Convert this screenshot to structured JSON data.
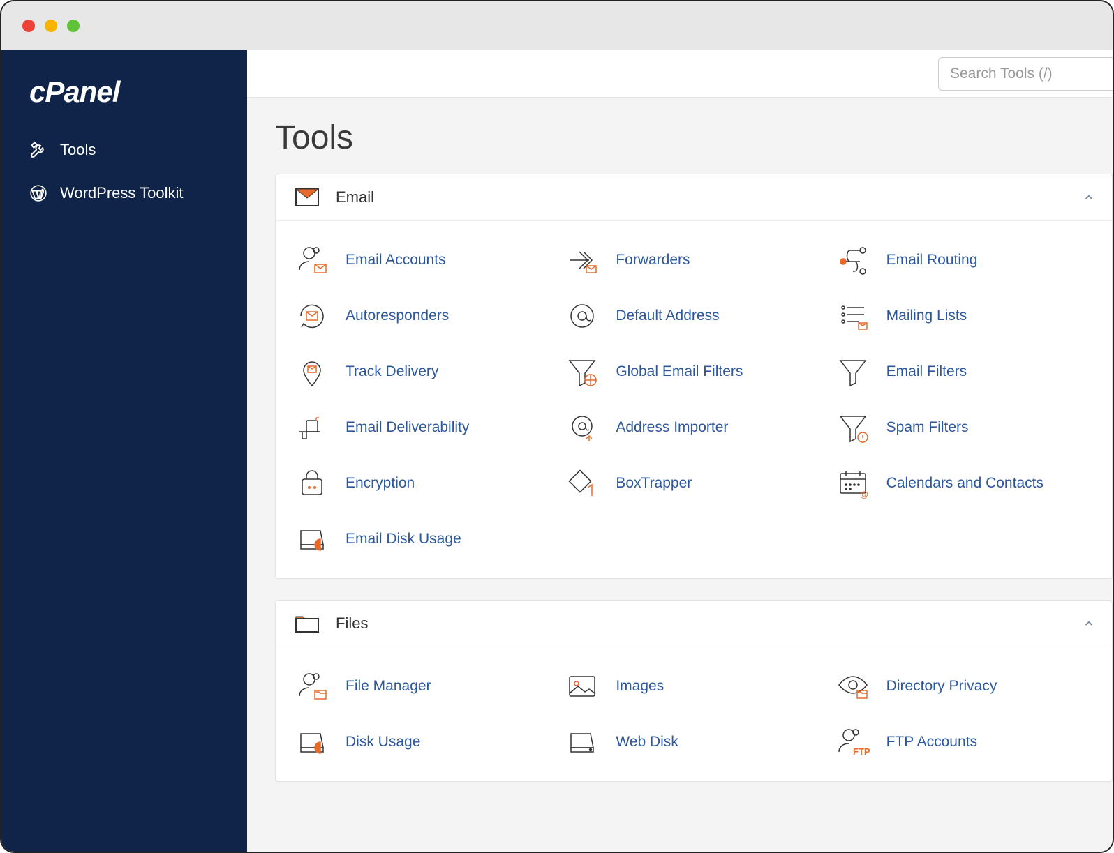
{
  "logo_text": "cPanel",
  "sidebar": {
    "items": [
      {
        "label": "Tools"
      },
      {
        "label": "WordPress Toolkit"
      }
    ]
  },
  "search": {
    "placeholder": "Search Tools (/)"
  },
  "page_title": "Tools",
  "sections": {
    "email": {
      "title": "Email",
      "items": [
        {
          "label": "Email Accounts"
        },
        {
          "label": "Forwarders"
        },
        {
          "label": "Email Routing"
        },
        {
          "label": "Autoresponders"
        },
        {
          "label": "Default Address"
        },
        {
          "label": "Mailing Lists"
        },
        {
          "label": "Track Delivery"
        },
        {
          "label": "Global Email Filters"
        },
        {
          "label": "Email Filters"
        },
        {
          "label": "Email Deliverability"
        },
        {
          "label": "Address Importer"
        },
        {
          "label": "Spam Filters"
        },
        {
          "label": "Encryption"
        },
        {
          "label": "BoxTrapper"
        },
        {
          "label": "Calendars and Contacts"
        },
        {
          "label": "Email Disk Usage"
        }
      ]
    },
    "files": {
      "title": "Files",
      "items": [
        {
          "label": "File Manager"
        },
        {
          "label": "Images"
        },
        {
          "label": "Directory Privacy"
        },
        {
          "label": "Disk Usage"
        },
        {
          "label": "Web Disk"
        },
        {
          "label": "FTP Accounts"
        }
      ]
    }
  }
}
